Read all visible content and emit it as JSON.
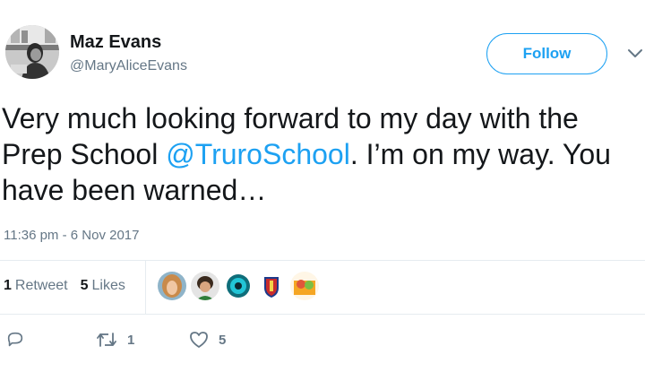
{
  "author": {
    "name": "Maz Evans",
    "handle": "@MaryAliceEvans"
  },
  "follow_button": {
    "label": "Follow"
  },
  "tweet": {
    "text_before": "Very much looking forward to my day with the Prep School ",
    "mention": "@TruroSchool",
    "text_after": ". I’m on my way. You have been warned…",
    "timestamp": "11:36 pm - 6 Nov 2017"
  },
  "stats": {
    "retweets_count": "1",
    "retweets_label": "Retweet",
    "likes_count": "5",
    "likes_label": "Likes"
  },
  "likers": [
    {
      "name": "liker-avatar-1"
    },
    {
      "name": "liker-avatar-2"
    },
    {
      "name": "liker-avatar-3"
    },
    {
      "name": "liker-avatar-4"
    },
    {
      "name": "liker-avatar-5"
    }
  ],
  "actions": {
    "retweet_count": "1",
    "like_count": "5"
  },
  "colors": {
    "accent": "#1da1f2",
    "secondary_text": "#657786",
    "divider": "#e6ecf0"
  },
  "icons": [
    "reply-icon",
    "retweet-icon",
    "like-icon",
    "chevron-down-icon"
  ]
}
